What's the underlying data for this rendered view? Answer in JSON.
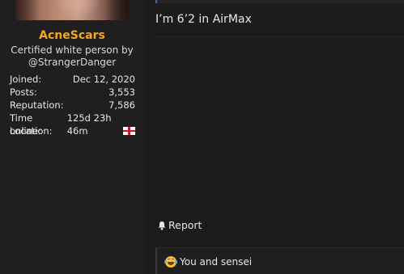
{
  "user": {
    "username": "AcneScars",
    "title_line1": "Certified white person by",
    "title_line2": "@StrangerDanger",
    "stats": [
      {
        "label": "Joined:",
        "value": "Dec 12, 2020"
      },
      {
        "label": "Posts:",
        "value": "3,553"
      },
      {
        "label": "Reputation:",
        "value": "7,586"
      },
      {
        "label": "Time online:",
        "value": "125d 23h 46m"
      },
      {
        "label": "Location:",
        "value": ""
      }
    ],
    "location_flag": "england-flag-icon",
    "username_color": "#f5a81e"
  },
  "post": {
    "message": "I’m 6’2 in AirMax",
    "report_label": "Report",
    "report_icon": "bell-icon",
    "reactions_text": "You and sensei",
    "reaction_icon": "joy-emoji-icon"
  }
}
